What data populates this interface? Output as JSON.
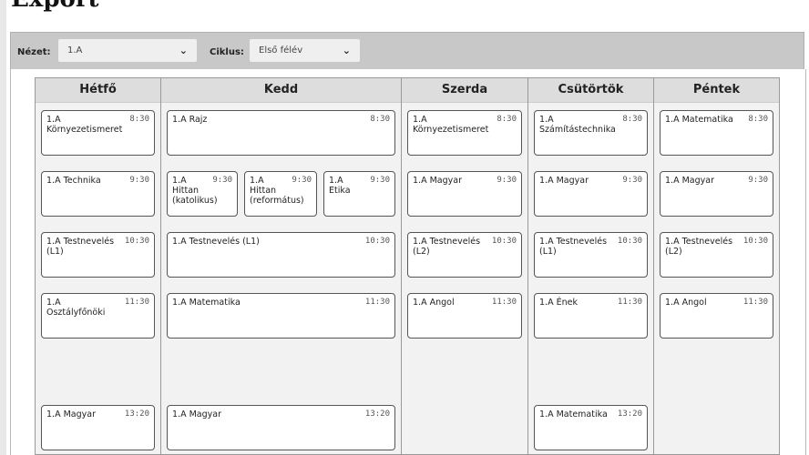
{
  "title": "Export",
  "filters": {
    "view_label": "Nézet:",
    "view_value": "1.A",
    "cycle_label": "Ciklus:",
    "cycle_value": "Első félév"
  },
  "days": [
    "Hétfő",
    "Kedd",
    "Szerda",
    "Csütörtök",
    "Péntek"
  ],
  "lessons": [
    {
      "day": 0,
      "slot": 0,
      "text": "1.A\nKörnyezetismeret",
      "time": "8:30"
    },
    {
      "day": 0,
      "slot": 1,
      "text": "1.A Technika",
      "time": "9:30"
    },
    {
      "day": 0,
      "slot": 2,
      "text": "1.A Testnevelés\n(L1)",
      "time": "10:30"
    },
    {
      "day": 0,
      "slot": 3,
      "text": "1.A\nOsztályfőnöki",
      "time": "11:30"
    },
    {
      "day": 0,
      "slot": 5,
      "text": "1.A Magyar",
      "time": "13:20"
    },
    {
      "day": 1,
      "slot": 0,
      "text": "1.A Rajz",
      "time": "8:30"
    },
    {
      "day": 1,
      "slot": 1,
      "sub": 0,
      "text": "1.A\nHittan\n(katolikus)",
      "time": "9:30"
    },
    {
      "day": 1,
      "slot": 1,
      "sub": 1,
      "text": "1.A\nHittan\n(református)",
      "time": "9:30"
    },
    {
      "day": 1,
      "slot": 1,
      "sub": 2,
      "text": "1.A\nEtika",
      "time": "9:30"
    },
    {
      "day": 1,
      "slot": 2,
      "text": "1.A Testnevelés (L1)",
      "time": "10:30"
    },
    {
      "day": 1,
      "slot": 3,
      "text": "1.A Matematika",
      "time": "11:30"
    },
    {
      "day": 1,
      "slot": 5,
      "text": "1.A Magyar",
      "time": "13:20"
    },
    {
      "day": 2,
      "slot": 0,
      "text": "1.A\nKörnyezetismeret",
      "time": "8:30"
    },
    {
      "day": 2,
      "slot": 1,
      "text": "1.A Magyar",
      "time": "9:30"
    },
    {
      "day": 2,
      "slot": 2,
      "text": "1.A Testnevelés\n(L2)",
      "time": "10:30"
    },
    {
      "day": 2,
      "slot": 3,
      "text": "1.A Angol",
      "time": "11:30"
    },
    {
      "day": 3,
      "slot": 0,
      "text": "1.A\nSzámítástechnika",
      "time": "8:30"
    },
    {
      "day": 3,
      "slot": 1,
      "text": "1.A Magyar",
      "time": "9:30"
    },
    {
      "day": 3,
      "slot": 2,
      "text": "1.A Testnevelés\n(L1)",
      "time": "10:30"
    },
    {
      "day": 3,
      "slot": 3,
      "text": "1.A Ének",
      "time": "11:30"
    },
    {
      "day": 3,
      "slot": 5,
      "text": "1.A Matematika",
      "time": "13:20"
    },
    {
      "day": 4,
      "slot": 0,
      "text": "1.A Matematika",
      "time": "8:30"
    },
    {
      "day": 4,
      "slot": 1,
      "text": "1.A Magyar",
      "time": "9:30"
    },
    {
      "day": 4,
      "slot": 2,
      "text": "1.A Testnevelés\n(L2)",
      "time": "10:30"
    },
    {
      "day": 4,
      "slot": 3,
      "text": "1.A Angol",
      "time": "11:30"
    }
  ]
}
